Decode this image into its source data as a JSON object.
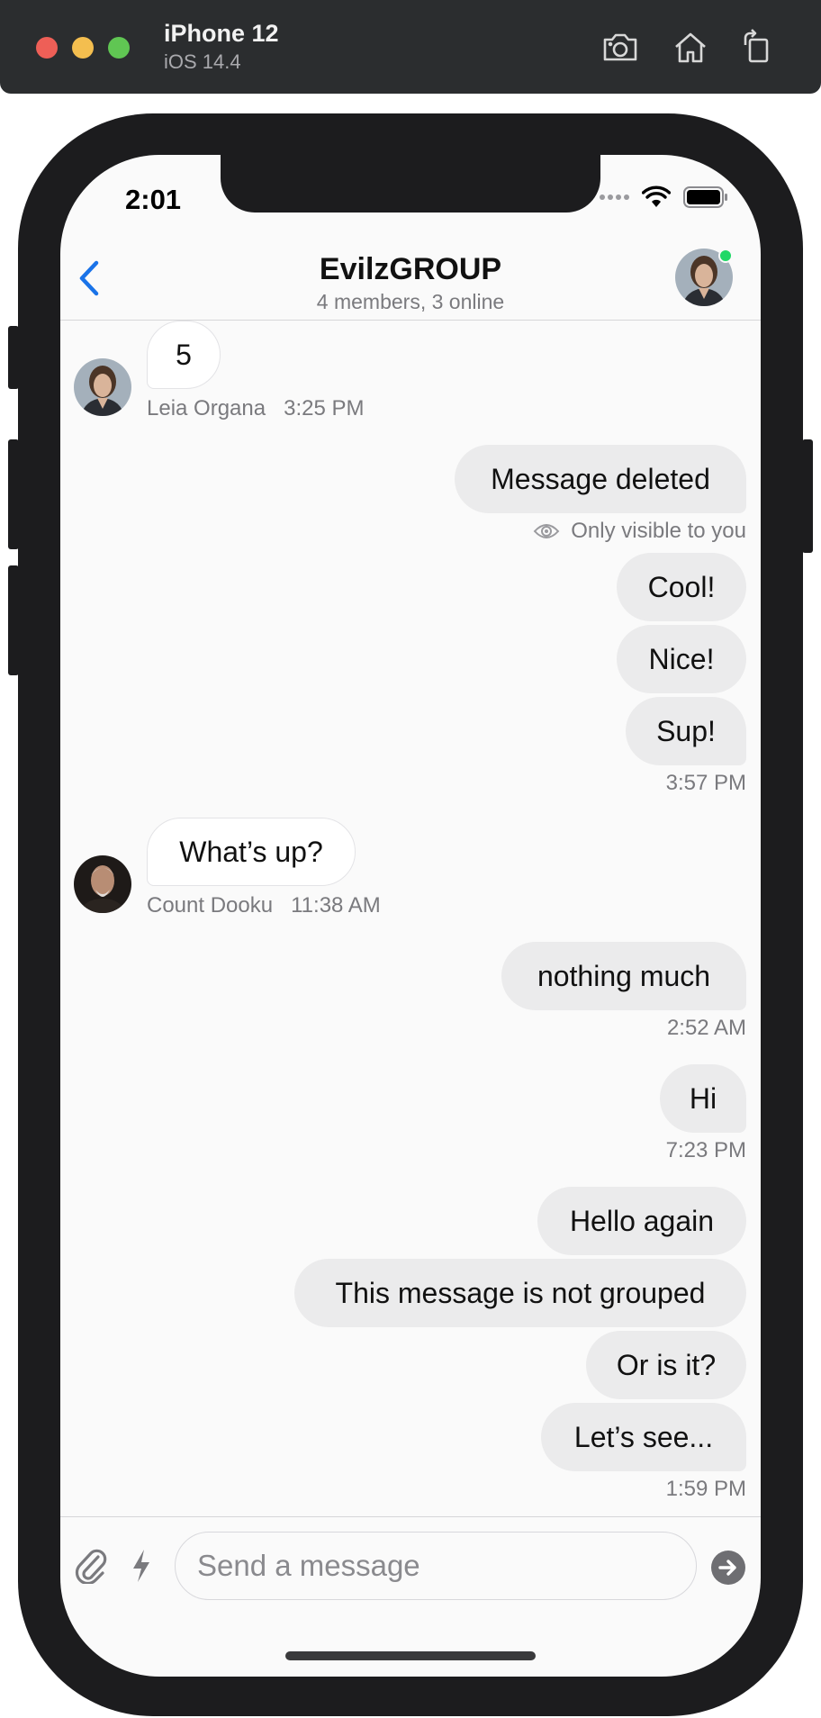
{
  "simulator": {
    "device_name": "iPhone 12",
    "os_version": "iOS 14.4",
    "tools": [
      "screenshot-icon",
      "home-icon",
      "rotate-icon"
    ]
  },
  "status_bar": {
    "time": "2:01"
  },
  "header": {
    "title": "EvilzGROUP",
    "subtitle": "4 members, 3 online",
    "online_color": "#20d867",
    "accent_color": "#1a73e8"
  },
  "messages": [
    {
      "text": "5",
      "author": "Leia Organa",
      "time": "3:25 PM",
      "direction": "incoming"
    },
    {
      "text": "Message deleted",
      "note": "Only visible to you",
      "direction": "outgoing"
    },
    {
      "text": "Cool!",
      "direction": "outgoing"
    },
    {
      "text": "Nice!",
      "direction": "outgoing"
    },
    {
      "text": "Sup!",
      "time": "3:57 PM",
      "direction": "outgoing"
    },
    {
      "text": "What’s up?",
      "author": "Count Dooku",
      "time": "11:38 AM",
      "direction": "incoming"
    },
    {
      "text": "nothing much",
      "time": "2:52 AM",
      "direction": "outgoing"
    },
    {
      "text": "Hi",
      "time": "7:23 PM",
      "direction": "outgoing"
    },
    {
      "text": "Hello again",
      "direction": "outgoing"
    },
    {
      "text": "This message is not grouped",
      "direction": "outgoing"
    },
    {
      "text": "Or is it?",
      "direction": "outgoing"
    },
    {
      "text": "Let’s see...",
      "time": "1:59 PM",
      "direction": "outgoing"
    }
  ],
  "composer": {
    "placeholder": "Send a message"
  }
}
